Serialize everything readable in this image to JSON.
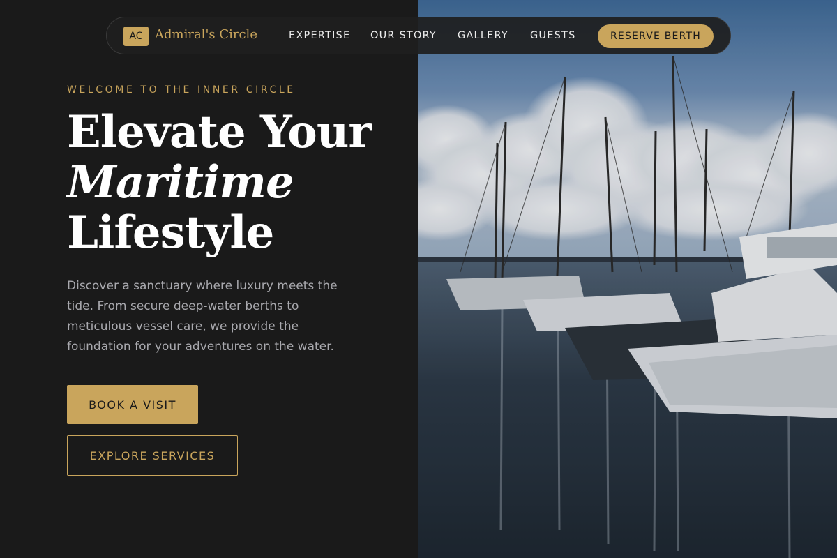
{
  "nav": {
    "logo_badge": "AC",
    "logo_text": "Admiral's Circle",
    "links": [
      {
        "label": "EXPERTISE"
      },
      {
        "label": "OUR STORY"
      },
      {
        "label": "GALLERY"
      },
      {
        "label": "GUESTS"
      }
    ],
    "cta_label": "RESERVE BERTH"
  },
  "hero": {
    "eyebrow": "WELCOME TO THE INNER CIRCLE",
    "headline_line1": "Elevate Your",
    "headline_line2": "Maritime",
    "headline_line3": "Lifestyle",
    "description": "Discover a sanctuary where luxury meets the tide. From secure deep-water berths to meticulous vessel care, we provide the foundation for your adventures on the water.",
    "primary_button": "BOOK A VISIT",
    "secondary_button": "EXPLORE SERVICES"
  },
  "image": {
    "subject": "marina-yachts-photo"
  },
  "colors": {
    "accent": "#c9a55c",
    "background": "#1a1a1a",
    "text": "#ffffff",
    "muted": "#a9a9ae"
  }
}
